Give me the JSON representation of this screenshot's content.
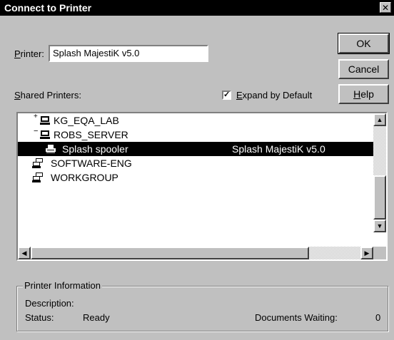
{
  "window": {
    "title": "Connect to Printer",
    "close_glyph": "✕"
  },
  "printer_field": {
    "label": "Printer:",
    "value": "Splash MajestiK v5.0"
  },
  "buttons": {
    "ok": "OK",
    "cancel": "Cancel",
    "help": "Help"
  },
  "shared_printers_label": "Shared Printers:",
  "expand_by_default": {
    "label": "Expand by Default",
    "checked": true
  },
  "tree": [
    {
      "name": "KG_EQA_LAB",
      "icon": "computer-icon",
      "expander": "+",
      "level": 1
    },
    {
      "name": "ROBS_SERVER",
      "icon": "computer-icon",
      "expander": "−",
      "level": 1
    },
    {
      "name": "Splash spooler",
      "icon": "printer-icon",
      "detail": "Splash MajestiK v5.0",
      "level": 2,
      "selected": true
    },
    {
      "name": "SOFTWARE-ENG",
      "icon": "workgroup-icon",
      "level": 0
    },
    {
      "name": "WORKGROUP",
      "icon": "workgroup-icon",
      "level": 0
    }
  ],
  "printer_info": {
    "legend": "Printer Information",
    "description_label": "Description:",
    "status_label": "Status:",
    "status_value": "Ready",
    "documents_waiting_label": "Documents Waiting:",
    "documents_waiting_value": "0"
  },
  "colors": {
    "face": "#c0c0c0",
    "selection": "#000000",
    "title_bar": "#000000"
  }
}
